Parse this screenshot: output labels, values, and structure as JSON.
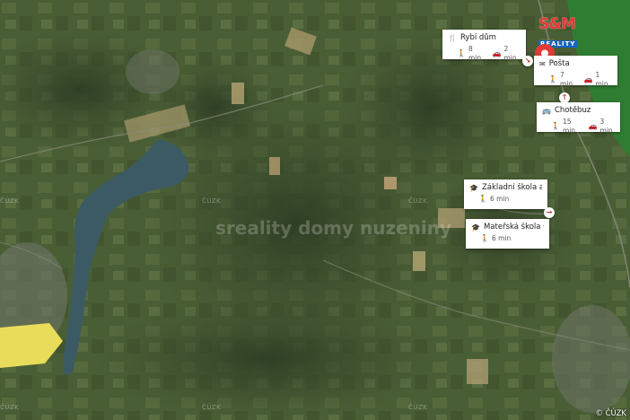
{
  "map": {
    "type": "satellite",
    "copyright": "© ČÚZK",
    "tile_watermark": "ČÚZK",
    "center_watermark": "sreality domy nuzeniny"
  },
  "branding": {
    "logo_top": "S&M",
    "logo_bottom": "REALITY"
  },
  "property_marker": {
    "icon": "map-pin-icon",
    "color": "#e53935"
  },
  "pois": [
    {
      "id": "rybi-dum",
      "icon": "restaurant-icon",
      "name": "Rybí dům",
      "walk": "8 min",
      "car": "2 min"
    },
    {
      "id": "posta",
      "icon": "post-icon",
      "name": "Pošta",
      "walk": "7 min",
      "car": "1 min"
    },
    {
      "id": "chotebuz",
      "icon": "bus-icon",
      "name": "Chotěbuz",
      "walk": "15 min",
      "car": "3 min"
    },
    {
      "id": "zakladni-skola",
      "icon": "school-icon",
      "name": "Základní škola a ...",
      "walk": "6 min"
    },
    {
      "id": "materska-skola",
      "icon": "school-icon",
      "name": "Mateřská škola C...",
      "walk": "6 min"
    }
  ],
  "colors": {
    "marker": "#e53935",
    "border_zone": "#2e7d32",
    "water": "#3c5a63",
    "field_yellow": "#e8dc5a"
  }
}
